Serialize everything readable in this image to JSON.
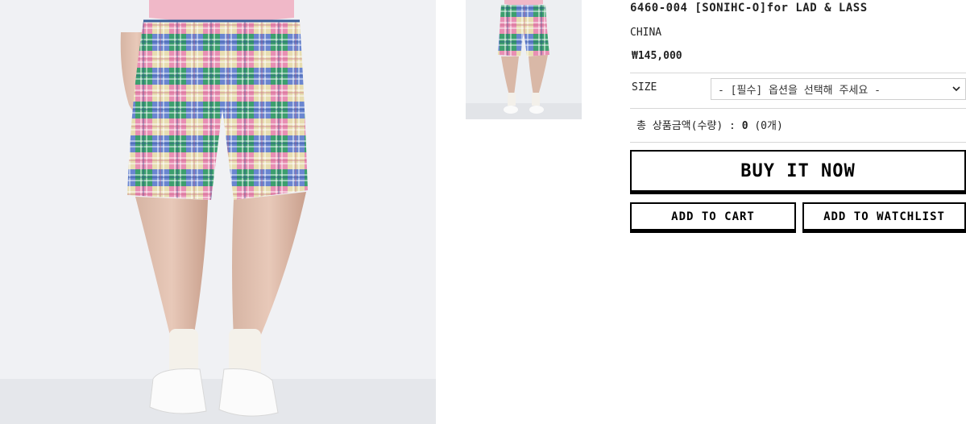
{
  "product": {
    "name": "6460-004 [SONIHC-O]for LAD & LASS",
    "origin": "CHINA",
    "price": "₩145,000"
  },
  "option": {
    "size_label": "SIZE",
    "size_selected": "- [필수] 옵션을 선택해 주세요 -"
  },
  "total": {
    "label": "총 상품금액(수량) :",
    "amount": "0",
    "count": "(0개)"
  },
  "buttons": {
    "buy_now": "BUY IT NOW",
    "add_to_cart": "ADD TO CART",
    "add_to_watchlist": "ADD TO WATCHLIST"
  },
  "icons": {
    "select_arrow": "chevron-down-icon"
  }
}
